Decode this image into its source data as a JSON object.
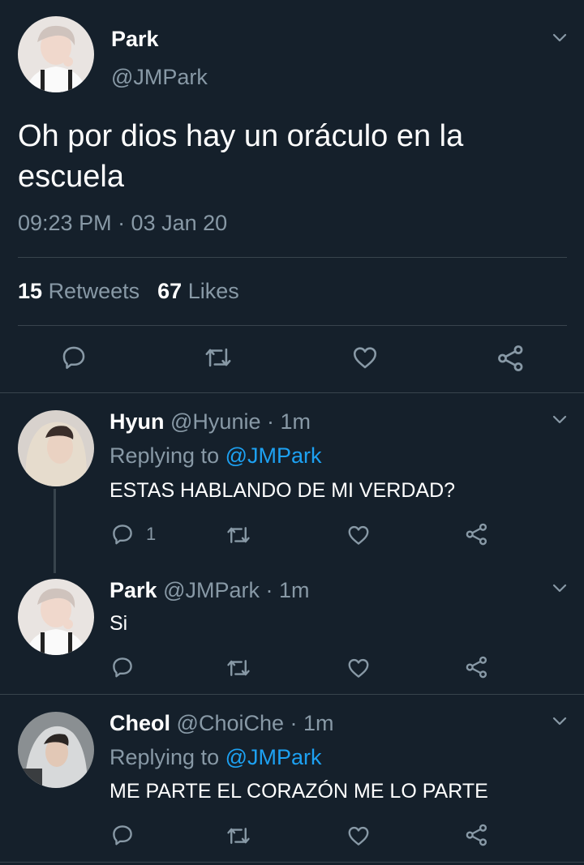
{
  "main_tweet": {
    "name": "Park",
    "handle": "@JMPark",
    "text": "Oh por dios hay un oráculo en la escuela",
    "timestamp": "09:23 PM · 03 Jan 20",
    "retweets_count": "15",
    "retweets_label": "Retweets",
    "likes_count": "67",
    "likes_label": "Likes"
  },
  "replies": [
    {
      "name": "Hyun",
      "handle": "@Hyunie",
      "time": "· 1m",
      "replying_prefix": "Replying to",
      "replying_to": "@JMPark",
      "text": "ESTAS HABLANDO DE MI VERDAD?",
      "reply_count": "1"
    },
    {
      "name": "Park",
      "handle": "@JMPark",
      "time": "· 1m",
      "text": "Si"
    },
    {
      "name": "Cheol",
      "handle": "@ChoiChe",
      "time": "· 1m",
      "replying_prefix": "Replying to",
      "replying_to": "@JMPark",
      "text": "ME PARTE EL CORAZÓN ME LO PARTE"
    }
  ],
  "colors": {
    "background": "#15202b",
    "secondary_text": "#8899a6",
    "link": "#1da1f2",
    "divider": "#38444d"
  },
  "icons": [
    "chevron-down-icon",
    "reply-icon",
    "retweet-icon",
    "like-icon",
    "share-icon"
  ]
}
